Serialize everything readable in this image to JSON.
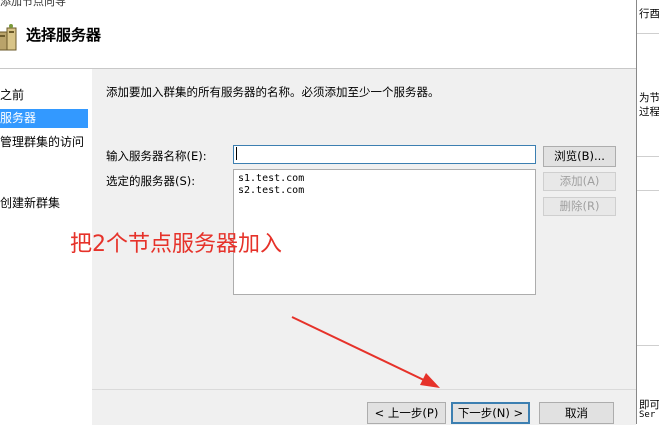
{
  "window": {
    "title_fragment": "添加节点向导"
  },
  "header": {
    "title": "选择服务器"
  },
  "steps": [
    {
      "label": "之前",
      "active": false
    },
    {
      "label": "服务器",
      "active": true
    },
    {
      "label": "管理群集的访问",
      "active": false
    },
    {
      "label": "创建新群集",
      "active": false
    }
  ],
  "main": {
    "instruction": "添加要加入群集的所有服务器的名称。必须添加至少一个服务器。",
    "server_name_label": "输入服务器名称(E):",
    "server_name_value": "",
    "selected_label": "选定的服务器(S):",
    "selected_servers": [
      "s1.test.com",
      "s2.test.com"
    ],
    "browse_label": "浏览(B)...",
    "add_label": "添加(A)",
    "remove_label": "删除(R)"
  },
  "footer": {
    "prev_label": "< 上一步(P)",
    "next_label": "下一步(N) >",
    "cancel_label": "取消"
  },
  "annotation": {
    "text": "把2个节点服务器加入",
    "color": "#e6322a"
  },
  "background_window": {
    "texts": [
      "行酉",
      "为节",
      "过程",
      "即可",
      "Ser"
    ]
  },
  "colors": {
    "accent": "#3399ff",
    "annotation": "#e6322a"
  },
  "icons": {
    "wizard": "server-cluster-icon"
  }
}
